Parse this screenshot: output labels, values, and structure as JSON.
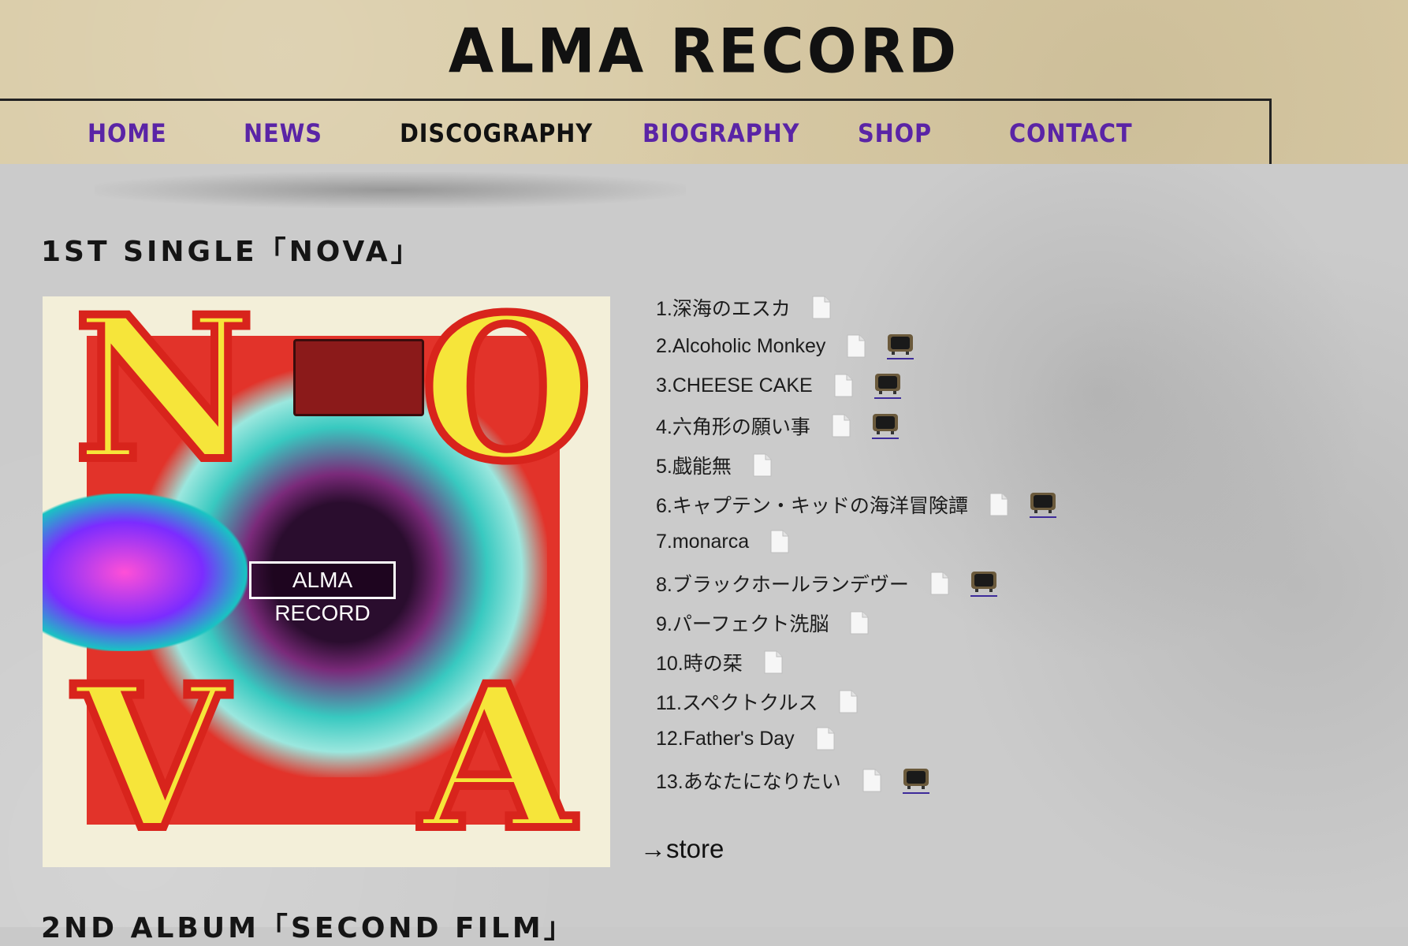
{
  "header": {
    "site_title": "ALMA RECORD"
  },
  "nav": [
    {
      "label": "HOME",
      "active": false
    },
    {
      "label": "NEWS",
      "active": false
    },
    {
      "label": "DISCOGRAPHY",
      "active": true
    },
    {
      "label": "BIOGRAPHY",
      "active": false
    },
    {
      "label": "SHOP",
      "active": false
    },
    {
      "label": "CONTACT",
      "active": false
    }
  ],
  "release1": {
    "title": "1ST SINGLE「NOVA」",
    "cover": {
      "letters": [
        "N",
        "O",
        "V",
        "A"
      ],
      "badge": "ALMA RECORD"
    },
    "tracks": [
      {
        "label": "1.深海のエスカ",
        "lyrics": true,
        "video": false
      },
      {
        "label": "2.Alcoholic Monkey",
        "lyrics": true,
        "video": true
      },
      {
        "label": "3.CHEESE CAKE",
        "lyrics": true,
        "video": true
      },
      {
        "label": "4.六角形の願い事",
        "lyrics": true,
        "video": true
      },
      {
        "label": "5.戯能無",
        "lyrics": true,
        "video": false
      },
      {
        "label": "6.キャプテン・キッドの海洋冒険譚",
        "lyrics": true,
        "video": true
      },
      {
        "label": "7.monarca",
        "lyrics": true,
        "video": false
      },
      {
        "label": "8.ブラックホールランデヴー",
        "lyrics": true,
        "video": true
      },
      {
        "label": "9.パーフェクト洗脳",
        "lyrics": true,
        "video": false
      },
      {
        "label": "10.時の栞",
        "lyrics": true,
        "video": false
      },
      {
        "label": "11.スペクトクルス",
        "lyrics": true,
        "video": false
      },
      {
        "label": "12.Father's Day",
        "lyrics": true,
        "video": false
      },
      {
        "label": "13.あなたになりたい",
        "lyrics": true,
        "video": true
      }
    ],
    "store_link": "→store"
  },
  "release2": {
    "title": "2ND ALBUM「SECOND FILM」"
  },
  "icons": {
    "lyrics": "document-icon",
    "video": "television-icon"
  },
  "colors": {
    "nav_link": "#5a24a6",
    "nav_active": "#111111",
    "header_bg": "#d9cba6",
    "content_bg": "#cbcbcb"
  }
}
